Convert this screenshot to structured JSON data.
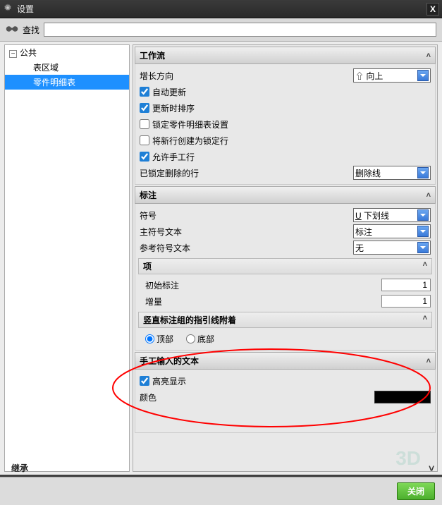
{
  "window": {
    "title": "设置"
  },
  "search": {
    "label": "查找",
    "value": ""
  },
  "tree": {
    "root": "公共",
    "children": [
      "表区域",
      "零件明细表"
    ],
    "selected_index": 1
  },
  "sections": {
    "workflow": {
      "title": "工作流",
      "growth_dir_label": "增长方向",
      "growth_dir_value": "⇧ 向上",
      "auto_update": "自动更新",
      "sort_on_update": "更新时排序",
      "lock_bom_settings": "锁定零件明细表设置",
      "new_rows_locked": "将新行创建为锁定行",
      "allow_manual": "允许手工行",
      "locked_deleted_label": "已锁定删除的行",
      "locked_deleted_value": "删除线",
      "checks": {
        "auto_update": true,
        "sort_on_update": true,
        "lock_bom_settings": false,
        "new_rows_locked": false,
        "allow_manual": true
      }
    },
    "callout": {
      "title": "标注",
      "symbol_label": "符号",
      "symbol_value": "U 下划线",
      "main_text_label": "主符号文本",
      "main_text_value": "标注",
      "ref_text_label": "参考符号文本",
      "ref_text_value": "无",
      "items_header": "项",
      "initial_label": "初始标注",
      "initial_value": "1",
      "increment_label": "增量",
      "increment_value": "1",
      "leader_header": "竖直标注组的指引线附着",
      "radio_top": "顶部",
      "radio_bottom": "底部",
      "radio_selected": "top"
    },
    "manual": {
      "title": "手工输入的文本",
      "highlight_label": "高亮显示",
      "highlight_checked": true,
      "color_label": "颜色",
      "color_value": "#000000"
    }
  },
  "inherit": "继承",
  "footer": {
    "close": "关闭"
  },
  "icons": {
    "gear": "gear",
    "close_x": "X",
    "chev_up": "˄",
    "chev_down": "˅",
    "arrow": "▼",
    "underline_u": "U"
  }
}
